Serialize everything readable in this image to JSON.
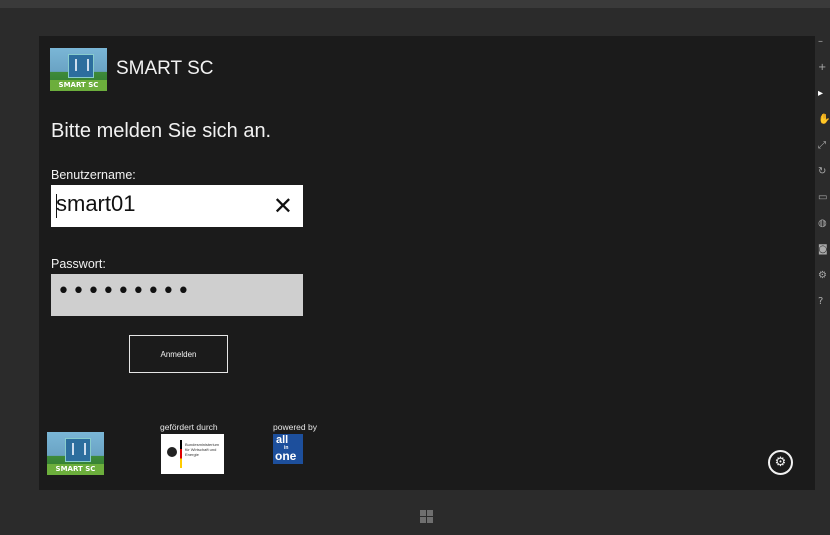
{
  "app": {
    "title": "SMART SC",
    "logo_text": "SMART SC"
  },
  "login": {
    "headline": "Bitte melden Sie sich an.",
    "username_label": "Benutzername:",
    "username_value": "smart01",
    "clear_glyph": "✕",
    "password_label": "Passwort:",
    "password_mask": "•••••••••",
    "submit_label": "Anmelden"
  },
  "footer": {
    "funded_label": "gefördert durch",
    "powered_label": "powered by",
    "bmwi_text": "Bundesministerium für Wirtschaft und Energie",
    "allinone_parts": [
      "all",
      "in",
      "one"
    ],
    "settings_glyph": "⚙"
  },
  "colors": {
    "screen_bg": "#1b1b1b",
    "bezel": "#2b2b2b",
    "password_field_bg": "#cfcfcf",
    "allinone_blue": "#1d4f9c",
    "logo_green": "#6cae3c"
  }
}
